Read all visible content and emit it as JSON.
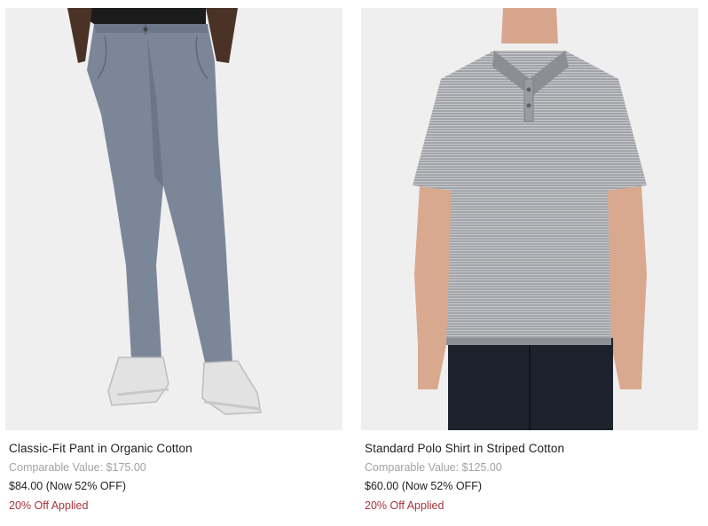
{
  "products": [
    {
      "name": "Classic-Fit Pant in Organic Cotton",
      "comparable_value": "Comparable Value: $175.00",
      "price": "$84.00 (Now 52% OFF)",
      "promo": "20% Off Applied",
      "image_label": "product-image-pant"
    },
    {
      "name": "Standard Polo Shirt in Striped Cotton",
      "comparable_value": "Comparable Value: $125.00",
      "price": "$60.00 (Now 52% OFF)",
      "promo": "20% Off Applied",
      "image_label": "product-image-polo"
    }
  ],
  "colors": {
    "image_bg": "#efefef",
    "promo": "#a8343a",
    "muted": "#a3a3a3",
    "text": "#1f1f1f"
  }
}
